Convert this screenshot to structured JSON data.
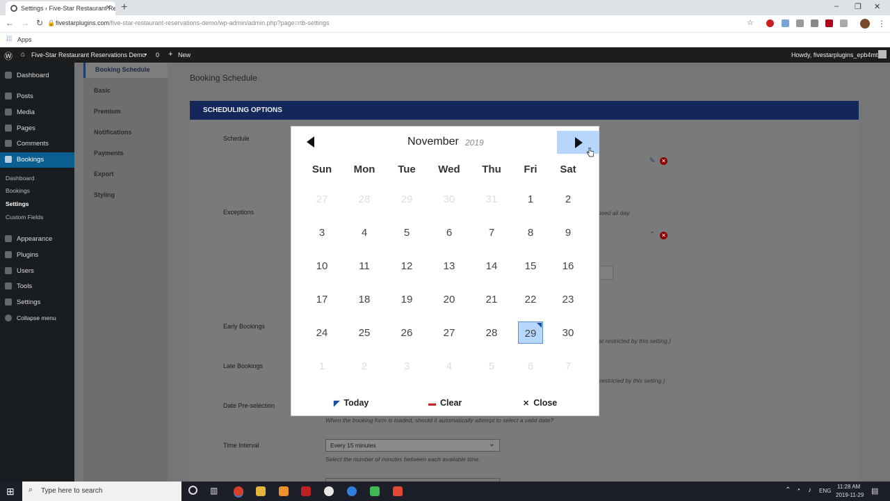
{
  "browser": {
    "tab_title": "Settings ‹ Five-Star Restaurant Re",
    "url_host": "fivestarplugins.com",
    "url_path": "/five-star-restaurant-reservations-demo/wp-admin/admin.php?page=rtb-settings",
    "bookmarks_apps": "Apps",
    "win_minimize": "–",
    "win_restore": "❐",
    "win_close": "✕"
  },
  "adminbar": {
    "site_name": "Five-Star Restaurant Reservations Demo",
    "comments_count": "0",
    "new_label": "New",
    "howdy": "Howdy, fivestarplugins_epb4mt"
  },
  "sidebar": {
    "items": [
      {
        "label": "Dashboard"
      },
      {
        "label": "Posts"
      },
      {
        "label": "Media"
      },
      {
        "label": "Pages"
      },
      {
        "label": "Comments"
      },
      {
        "label": "Bookings"
      },
      {
        "label": "Appearance"
      },
      {
        "label": "Plugins"
      },
      {
        "label": "Users"
      },
      {
        "label": "Tools"
      },
      {
        "label": "Settings"
      },
      {
        "label": "Collapse menu"
      }
    ],
    "subitems": [
      {
        "label": "Dashboard"
      },
      {
        "label": "Bookings"
      },
      {
        "label": "Settings"
      },
      {
        "label": "Custom Fields"
      }
    ]
  },
  "settings_tabs": [
    "Booking Schedule",
    "Basic",
    "Premium",
    "Notifications",
    "Payments",
    "Export",
    "Styling"
  ],
  "page": {
    "title": "Booking Schedule",
    "section_header": "SCHEDULING OPTIONS",
    "labels": {
      "schedule": "Schedule",
      "exceptions": "Exceptions",
      "early": "Early Bookings",
      "late": "Late Bookings",
      "preselect": "Date Pre-selection",
      "interval": "Time Interval"
    },
    "help": {
      "closed": "osed all day.",
      "early": "at restricted by this setting.)",
      "late": "restricted by this setting.)",
      "preselect": "When the booking form is loaded, should it automatically attempt to select a valid date?",
      "interval": "Select the number of minutes between each available time."
    },
    "interval_value": "Every 15 minutes"
  },
  "datepicker": {
    "month": "November",
    "year": "2019",
    "weekdays": [
      "Sun",
      "Mon",
      "Tue",
      "Wed",
      "Thu",
      "Fri",
      "Sat"
    ],
    "weeks": [
      [
        "27",
        "28",
        "29",
        "30",
        "31",
        "1",
        "2"
      ],
      [
        "3",
        "4",
        "5",
        "6",
        "7",
        "8",
        "9"
      ],
      [
        "10",
        "11",
        "12",
        "13",
        "14",
        "15",
        "16"
      ],
      [
        "17",
        "18",
        "19",
        "20",
        "21",
        "22",
        "23"
      ],
      [
        "24",
        "25",
        "26",
        "27",
        "28",
        "29",
        "30"
      ],
      [
        "1",
        "2",
        "3",
        "4",
        "5",
        "6",
        "7"
      ]
    ],
    "selected_day": "29",
    "today_label": "Today",
    "clear_label": "Clear",
    "close_label": "Close"
  },
  "taskbar": {
    "search_placeholder": "Type here to search",
    "lang": "ENG",
    "time": "11:28 AM",
    "date": "2019-11-29"
  }
}
